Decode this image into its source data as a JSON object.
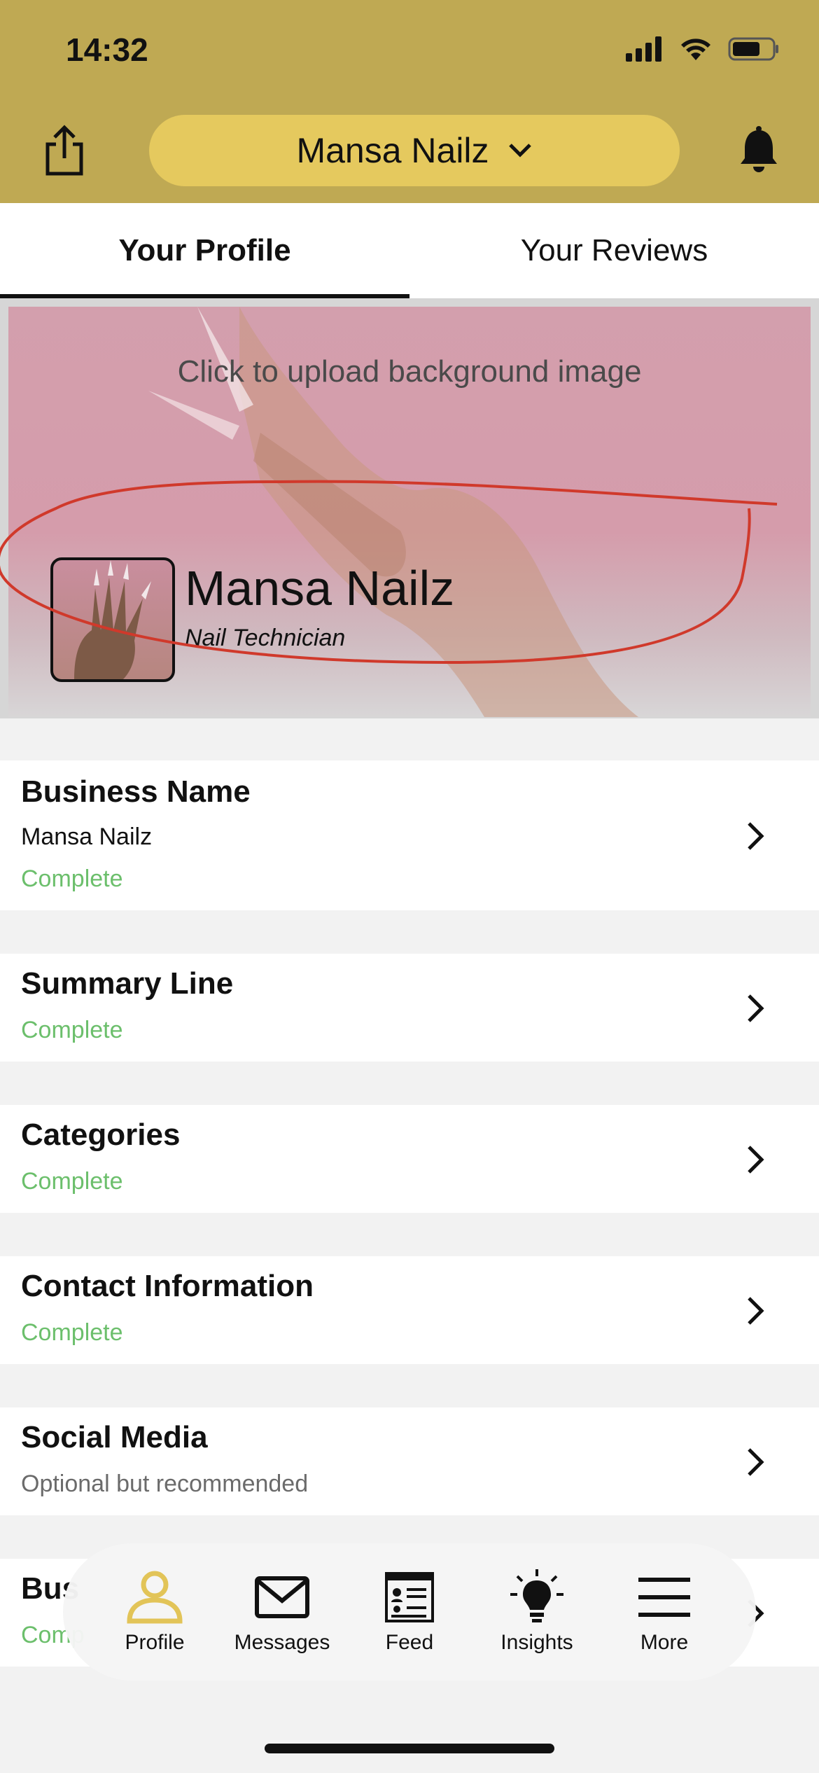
{
  "status_bar": {
    "time": "14:32"
  },
  "header": {
    "business_name": "Mansa Nailz"
  },
  "tabs": [
    {
      "label": "Your Profile",
      "active": true
    },
    {
      "label": "Your Reviews",
      "active": false
    }
  ],
  "banner": {
    "upload_prompt": "Click to upload background image",
    "profile_name": "Mansa Nailz",
    "profile_role": "Nail Technician"
  },
  "sections": [
    {
      "title": "Business Name",
      "value": "Mansa Nailz",
      "status": "Complete"
    },
    {
      "title": "Summary Line",
      "status": "Complete"
    },
    {
      "title": "Categories",
      "status": "Complete"
    },
    {
      "title": "Contact Information",
      "status": "Complete"
    },
    {
      "title": "Social Media",
      "status": "Optional but recommended"
    },
    {
      "title": "Bus",
      "status": "Comp"
    }
  ],
  "bottom_nav": [
    {
      "label": "Profile",
      "icon": "person-icon",
      "active": true
    },
    {
      "label": "Messages",
      "icon": "envelope-icon",
      "active": false
    },
    {
      "label": "Feed",
      "icon": "newspaper-icon",
      "active": false
    },
    {
      "label": "Insights",
      "icon": "lightbulb-icon",
      "active": false
    },
    {
      "label": "More",
      "icon": "menu-icon",
      "active": false
    }
  ],
  "colors": {
    "header_bg": "#bfa953",
    "selector_bg": "#e5c95e",
    "complete_green": "#6cbf6c",
    "active_nav": "#e2c458",
    "annotation_red": "#d0392b"
  }
}
